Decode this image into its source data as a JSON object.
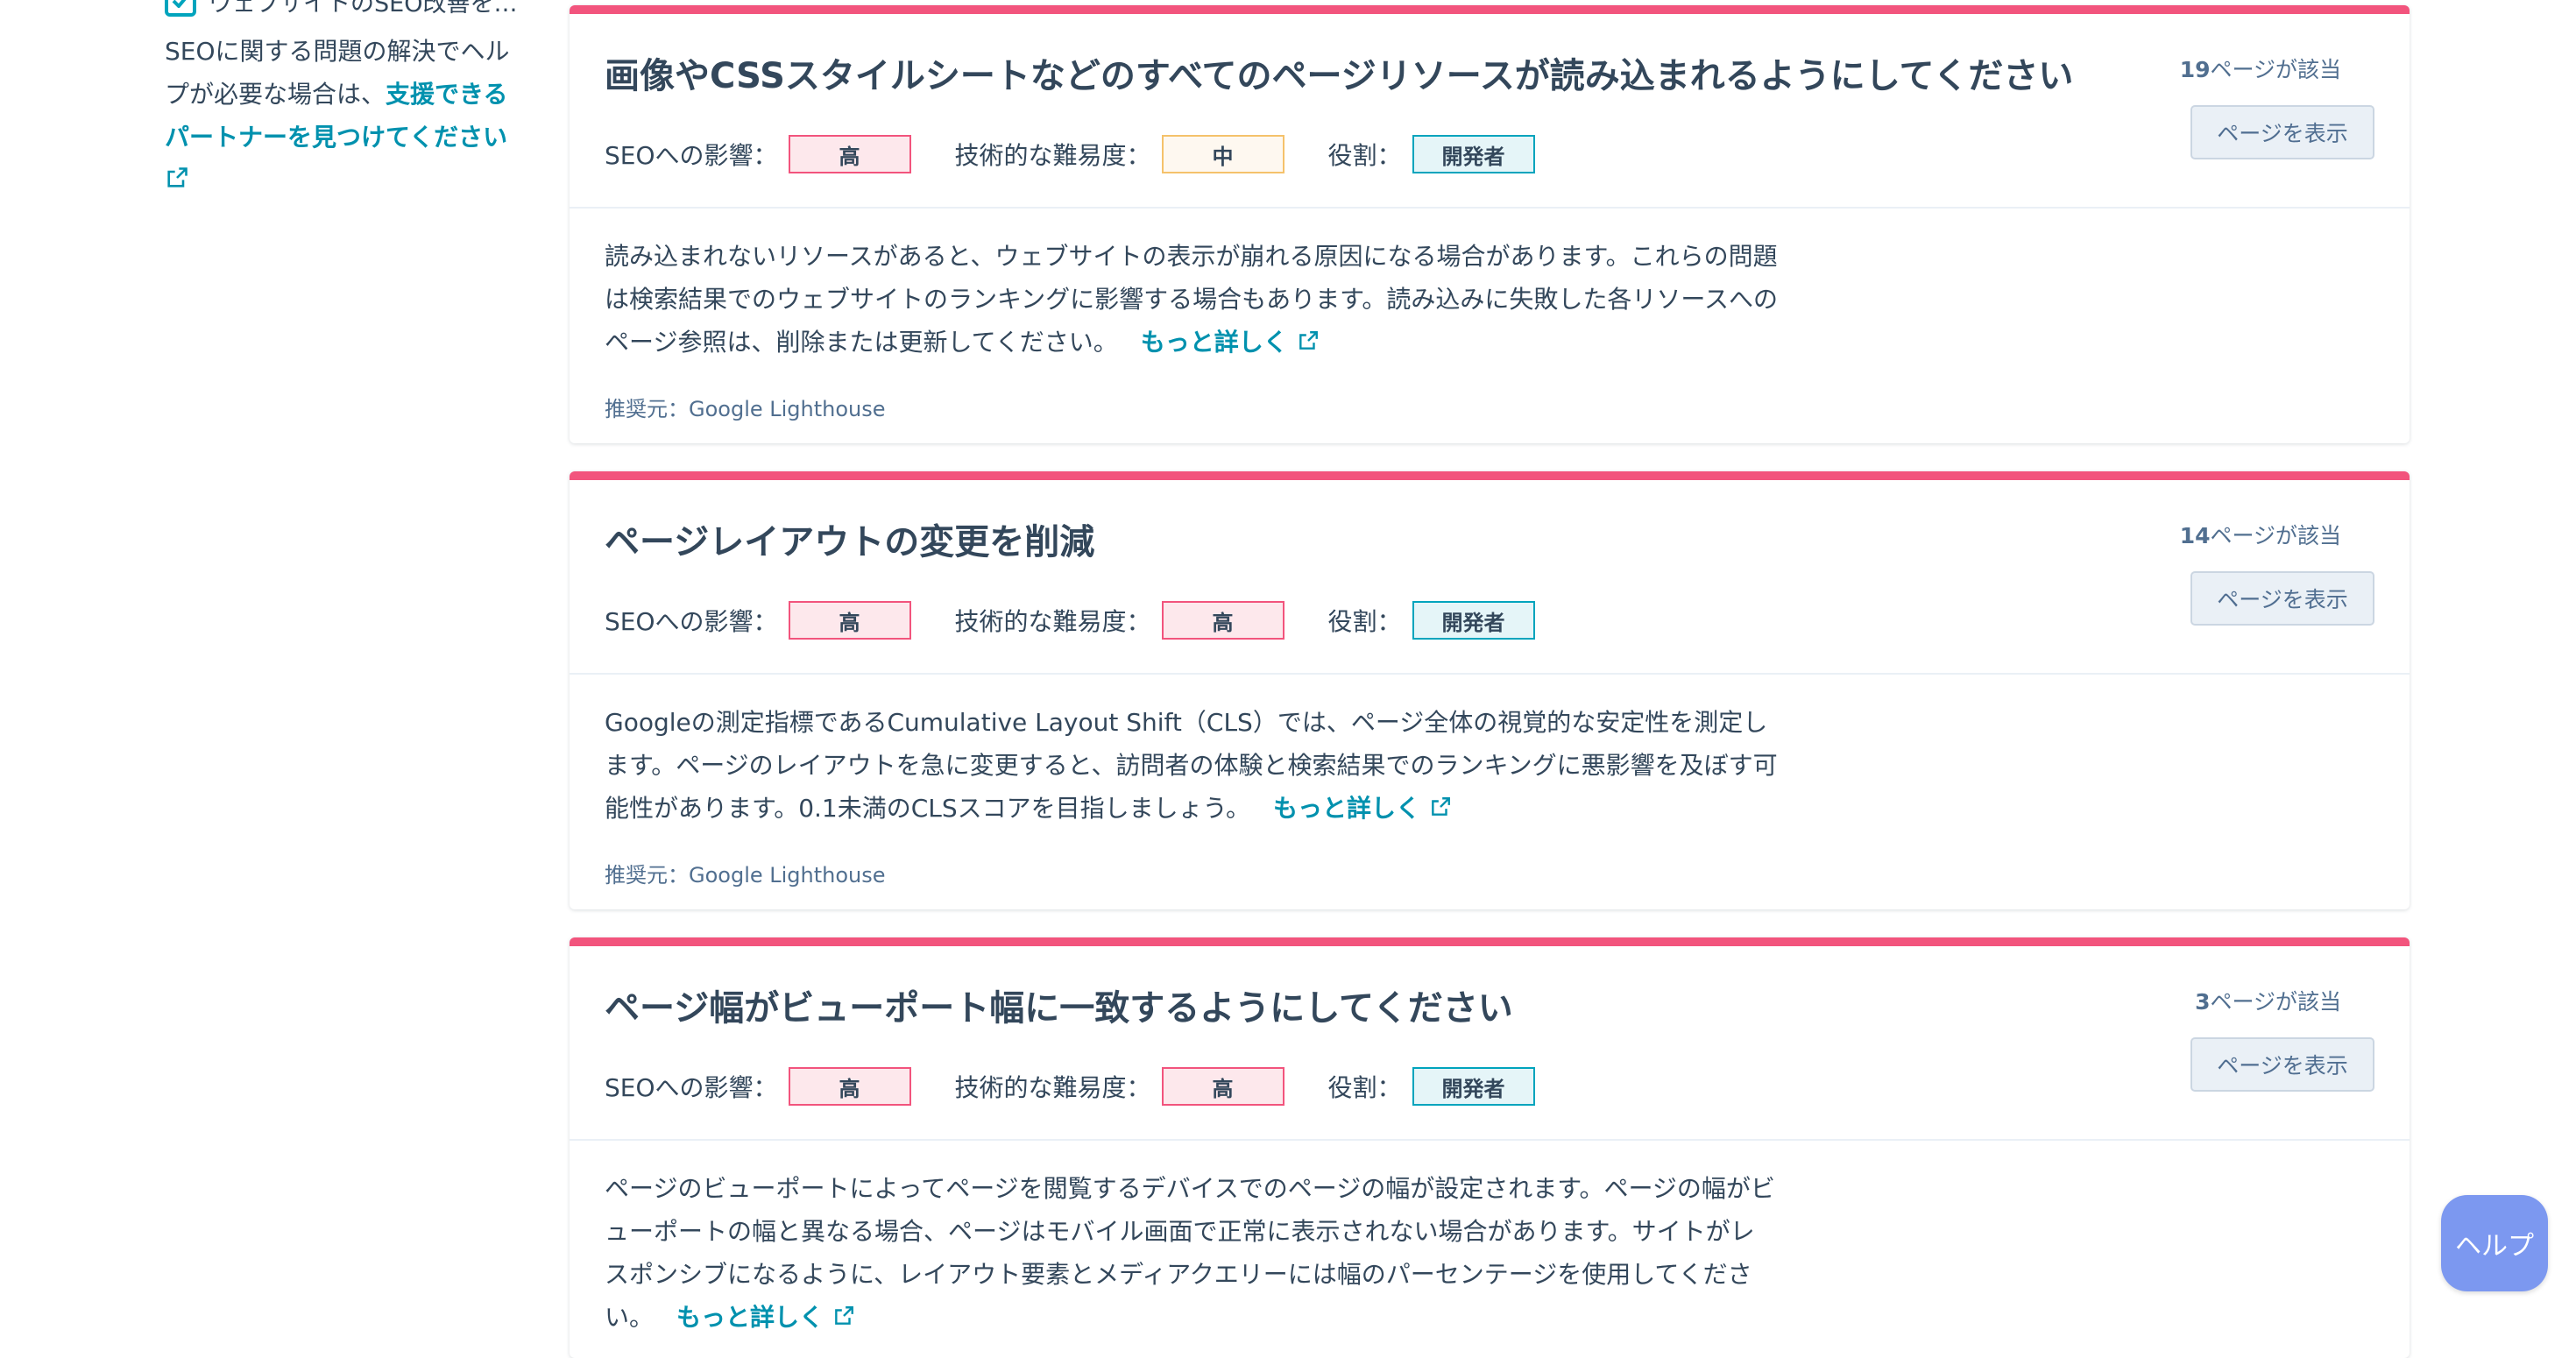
{
  "sidebar": {
    "check_label": "ウェブサイトのSEO改善を…",
    "help_text": "SEOに関する問題の解決でヘルプが必要な場合は、",
    "partner_link": "支援できるパートナーを見つけてください"
  },
  "labels": {
    "seo_impact": "SEOへの影響：",
    "difficulty": "技術的な難易度：",
    "role": "役割：",
    "view_pages": "ページを表示",
    "more": "もっと詳しく",
    "pages_suffix": "ページが該当"
  },
  "cards": [
    {
      "title": "画像やCSSスタイルシートなどのすべてのページリソースが読み込まれるようにしてください",
      "pages_count": "19",
      "seo_impact": "高",
      "difficulty": "中",
      "role": "開発者",
      "description": "読み込まれないリソースがあると、ウェブサイトの表示が崩れる原因になる場合があります。これらの問題は検索結果でのウェブサイトのランキングに影響する場合もあります。読み込みに失敗した各リソースへのページ参照は、削除または更新してください。",
      "source": "推奨元：Google Lighthouse"
    },
    {
      "title": "ページレイアウトの変更を削減",
      "pages_count": "14",
      "seo_impact": "高",
      "difficulty": "高",
      "role": "開発者",
      "description": "Googleの測定指標であるCumulative Layout Shift（CLS）では、ページ全体の視覚的な安定性を測定します。ページのレイアウトを急に変更すると、訪問者の体験と検索結果でのランキングに悪影響を及ぼす可能性があります。0.1未満のCLSスコアを目指しましょう。",
      "source": "推奨元：Google Lighthouse"
    },
    {
      "title": "ページ幅がビューポート幅に一致するようにしてください",
      "pages_count": "3",
      "seo_impact": "高",
      "difficulty": "高",
      "role": "開発者",
      "description": "ページのビューポートによってページを閲覧するデバイスでのページの幅が設定されます。ページの幅がビューポートの幅と異なる場合、ページはモバイル画面で正常に表示されない場合があります。サイトがレスポンシブになるように、レイアウト要素とメディアクエリーには幅のパーセンテージを使用してください。",
      "source": ""
    }
  ],
  "help_button": "ヘルプ",
  "colors": {
    "accent_border": "#f2547d",
    "link": "#0091ae",
    "text": "#33475b",
    "help_bg": "#7c98f0"
  }
}
